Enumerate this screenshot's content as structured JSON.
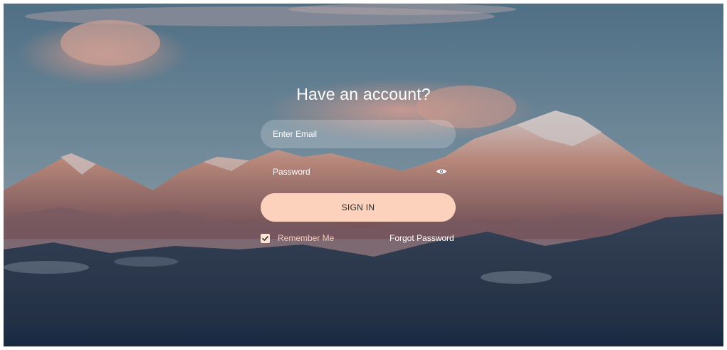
{
  "form": {
    "title": "Have an account?",
    "email_placeholder": "Enter Email",
    "password_placeholder": "Password",
    "signin_label": "SIGN IN",
    "remember_label": "Remember Me",
    "remember_checked": true,
    "forgot_label": "Forgot Password"
  },
  "icons": {
    "password_toggle": "eye-icon",
    "checkbox": "check-icon"
  },
  "colors": {
    "button_bg": "#fdd2bd",
    "button_text": "#2a2a2a",
    "text_white": "#ffffff",
    "remember_text": "#f6cdbc"
  }
}
